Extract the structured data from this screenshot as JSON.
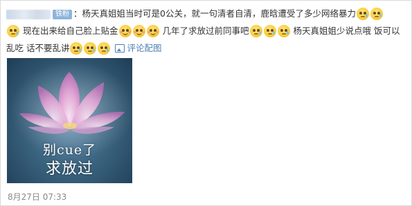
{
  "comment": {
    "fan_badge": "铁粉",
    "text_1": "：杨天真姐姐当时可是0公关，就一句清者自清，鹿晗遭受了多少网络暴力",
    "text_2": "现在出来给自己脸上贴金",
    "text_3": "几年了求放过前同事吧",
    "text_4": "杨天真姐姐少说点哦 饭可以乱吃 话不要乱讲",
    "view_picture_link": "评论配图",
    "emoji_names": [
      "sad-emoji",
      "smile-emoji"
    ]
  },
  "photo": {
    "caption_line1": "别cue了",
    "caption_line2": "求放过"
  },
  "timestamp": "8月27日 07:33",
  "colors": {
    "link": "#4c7fb2",
    "badge": "#8fb4dc",
    "timestamp": "#888888"
  }
}
